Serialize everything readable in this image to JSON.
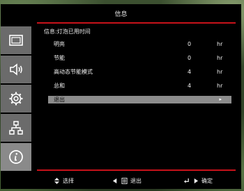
{
  "title": "信息",
  "sidebar": {
    "items": [
      {
        "icon": "screen-icon"
      },
      {
        "icon": "speaker-icon"
      },
      {
        "icon": "gear-icon"
      },
      {
        "icon": "network-icon"
      },
      {
        "icon": "info-icon",
        "active": true
      }
    ]
  },
  "section_title": "信息:灯泡已用时间",
  "rows": [
    {
      "label": "明亮",
      "value": "0",
      "unit": "hr"
    },
    {
      "label": "节能",
      "value": "0",
      "unit": "hr"
    },
    {
      "label": "高动态节能模式",
      "value": "4",
      "unit": "hr"
    },
    {
      "label": "总和",
      "value": "4",
      "unit": "hr"
    }
  ],
  "exit_row": {
    "label": "退出",
    "arrow": "▸"
  },
  "footer": {
    "select_label": "选择",
    "exit_label": "退出",
    "confirm_label": "确定"
  },
  "colors": {
    "accent": "#c8121a",
    "sidebar": "#6b6b6b",
    "highlight": "#8c8c8c"
  }
}
